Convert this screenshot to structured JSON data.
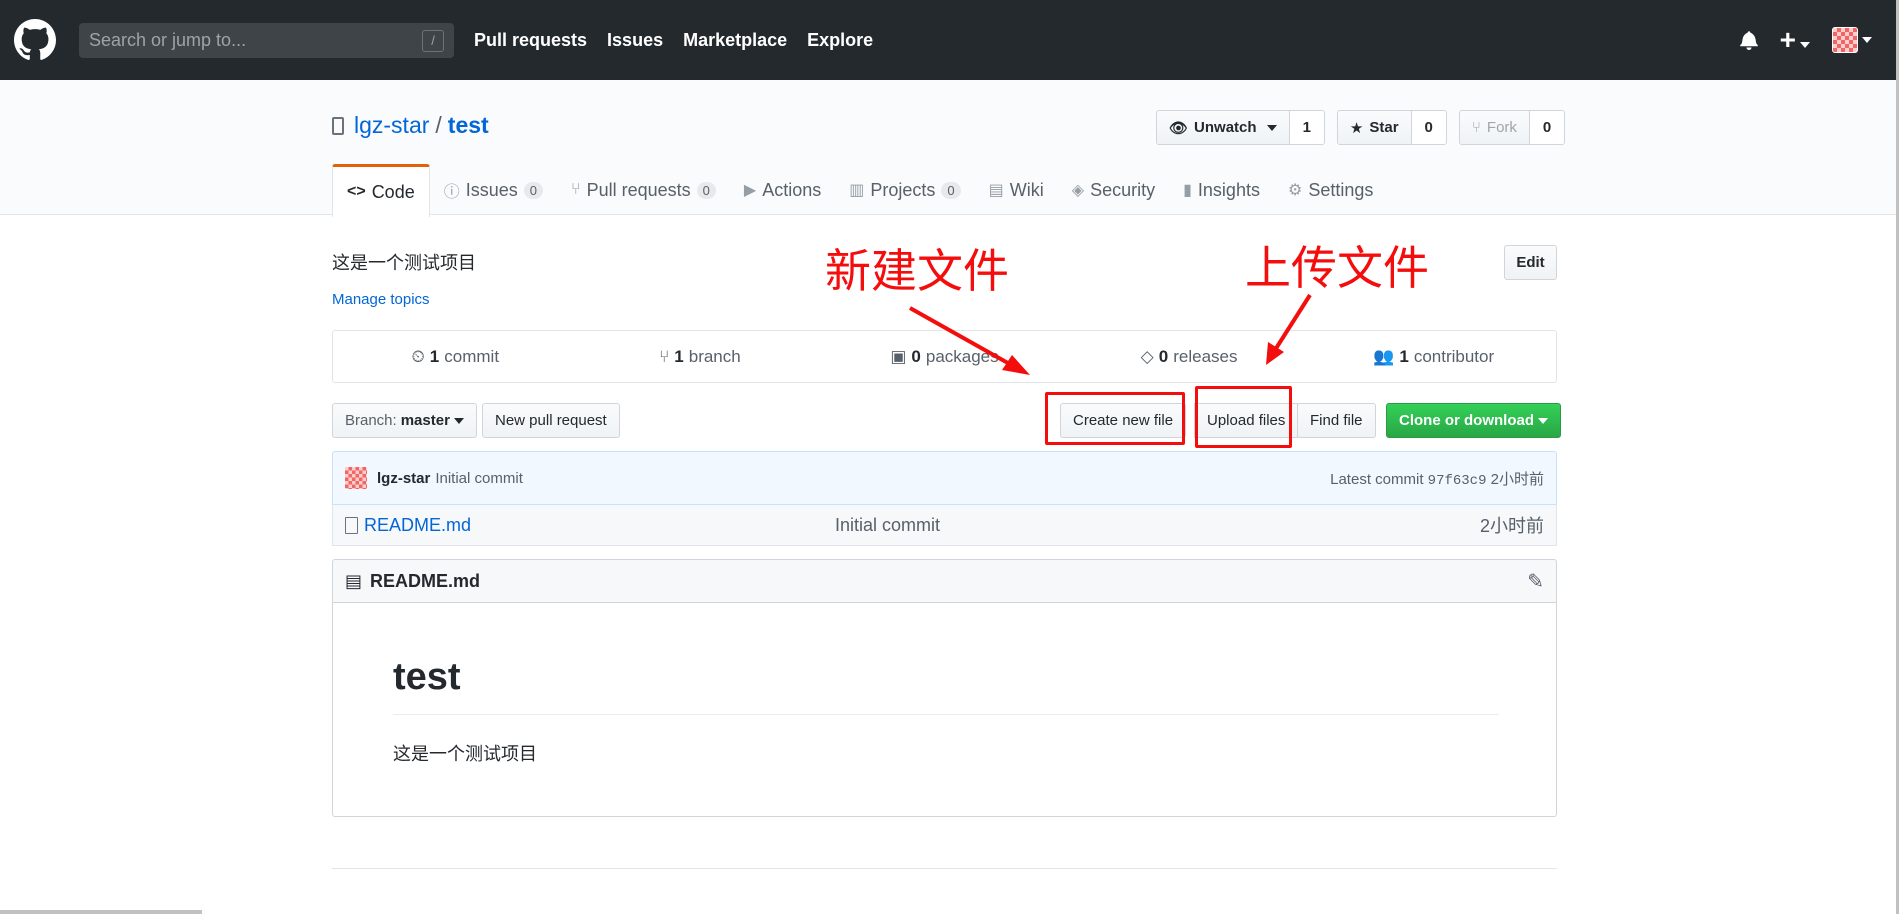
{
  "header": {
    "search_placeholder": "Search or jump to...",
    "search_shortcut": "/",
    "nav": [
      "Pull requests",
      "Issues",
      "Marketplace",
      "Explore"
    ]
  },
  "repo": {
    "owner": "lgz-star",
    "separator": "/",
    "name": "test",
    "watch_label": "Unwatch",
    "watch_count": "1",
    "star_label": "Star",
    "star_count": "0",
    "fork_label": "Fork",
    "fork_count": "0"
  },
  "tabs": [
    {
      "label": "Code",
      "icon": "code-icon"
    },
    {
      "label": "Issues",
      "count": "0",
      "icon": "issue-icon"
    },
    {
      "label": "Pull requests",
      "count": "0",
      "icon": "pr-icon"
    },
    {
      "label": "Actions",
      "icon": "play-icon"
    },
    {
      "label": "Projects",
      "count": "0",
      "icon": "project-icon"
    },
    {
      "label": "Wiki",
      "icon": "book-icon"
    },
    {
      "label": "Security",
      "icon": "shield-icon"
    },
    {
      "label": "Insights",
      "icon": "graph-icon"
    },
    {
      "label": "Settings",
      "icon": "gear-icon"
    }
  ],
  "about": {
    "description": "这是一个测试项目",
    "manage_topics": "Manage topics",
    "edit_label": "Edit"
  },
  "numbers": {
    "commits_n": "1",
    "commits_label": "commit",
    "branches_n": "1",
    "branches_label": "branch",
    "packages_n": "0",
    "packages_label": "packages",
    "releases_n": "0",
    "releases_label": "releases",
    "contributors_n": "1",
    "contributors_label": "contributor"
  },
  "filebar": {
    "branch_prefix": "Branch:",
    "branch": "master",
    "new_pr": "New pull request",
    "create_file": "Create new file",
    "upload": "Upload files",
    "find": "Find file",
    "clone": "Clone or download"
  },
  "commit": {
    "author": "lgz-star",
    "message": "Initial commit",
    "latest_prefix": "Latest commit",
    "sha": "97f63c9",
    "age": "2小时前"
  },
  "files": [
    {
      "name": "README.md",
      "message": "Initial commit",
      "age": "2小时前"
    }
  ],
  "readme": {
    "filename": "README.md",
    "heading": "test",
    "body": "这是一个测试项目"
  },
  "annotations": {
    "new_file_label": "新建文件",
    "upload_label": "上传文件",
    "color": "#f40d0d"
  }
}
